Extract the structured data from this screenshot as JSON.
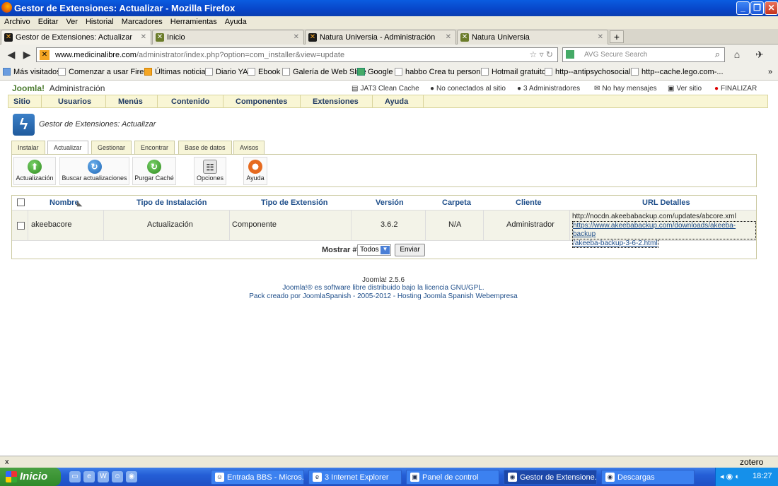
{
  "window": {
    "title": "Gestor de Extensiones: Actualizar - Mozilla Firefox"
  },
  "menubar": [
    "Archivo",
    "Editar",
    "Ver",
    "Historial",
    "Marcadores",
    "Herramientas",
    "Ayuda"
  ],
  "tabs": [
    {
      "label": "Gestor de Extensiones: Actualizar"
    },
    {
      "label": "Inicio"
    },
    {
      "label": "Natura Universia - Administración"
    },
    {
      "label": "Natura Universia"
    }
  ],
  "newtab_label": "+",
  "url": {
    "host": "www.medicinalibre.com",
    "path": "/administrator/index.php?option=com_installer&view=update"
  },
  "search": {
    "placeholder": "AVG Secure Search"
  },
  "bookmarks": [
    "Más visitados",
    "Comenzar a usar Firef...",
    "Últimas noticias",
    "Diario YA",
    "Ebook",
    "Galería de Web Slice",
    "Google",
    "habbo Crea tu person...",
    "Hotmail gratuito",
    "http--antipsychosocial...",
    "http--cache.lego.com-..."
  ],
  "joomla": {
    "logo": "Joomla!",
    "admin_label": "Administración",
    "status": [
      "JAT3 Clean Cache",
      "No conectados al sitio",
      "3 Administradores",
      "No hay mensajes",
      "Ver sitio",
      "FINALIZAR"
    ],
    "menu": [
      "Sitio",
      "Usuarios",
      "Menús",
      "Contenido",
      "Componentes",
      "Extensiones",
      "Ayuda"
    ],
    "page_title": "Gestor de Extensiones: Actualizar",
    "subtabs": [
      "Instalar",
      "Actualizar",
      "Gestionar",
      "Encontrar",
      "Base de datos",
      "Avisos"
    ],
    "toolbar": [
      "Actualización",
      "Buscar actualizaciones",
      "Purgar Caché",
      "Opciones",
      "Ayuda"
    ],
    "table": {
      "headers": [
        "Nombre",
        "Tipo de Instalación",
        "Tipo de Extensión",
        "Versión",
        "Carpeta",
        "Cliente",
        "URL Detalles"
      ],
      "rows": [
        {
          "name": "akeebacore",
          "install_type": "Actualización",
          "ext_type": "Componente",
          "version": "3.6.2",
          "folder": "N/A",
          "client": "Administrador",
          "urls": [
            "http://nocdn.akeebabackup.com/updates/abcore.xml",
            "https://www.akeebabackup.com/downloads/akeeba-backup",
            "/akeeba-backup-3-6-2.html"
          ]
        }
      ]
    },
    "show_label": "Mostrar #",
    "show_value": "Todos",
    "submit": "Enviar",
    "footer": [
      "Joomla! 2.5.6",
      "Joomla!® es software libre distribuido bajo la licencia GNU/GPL.",
      "Pack creado por JoomlaSpanish - 2005-2012 - Hosting Joomla Spanish Webempresa"
    ]
  },
  "statusbar": {
    "left": "x",
    "right": "zotero"
  },
  "taskbar": {
    "start": "Inicio",
    "items": [
      "Entrada BBS - Micros...",
      "3 Internet Explorer",
      "Panel de control",
      "Gestor de Extensione...",
      "Descargas"
    ],
    "clock": "18:27"
  }
}
